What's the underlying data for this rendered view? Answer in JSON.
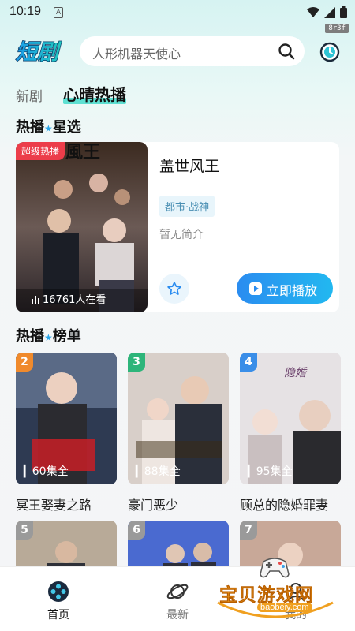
{
  "status": {
    "time": "10:19",
    "a_icon": "A",
    "badge": "8r3f"
  },
  "header": {
    "logo": "短剧",
    "search_placeholder": "人形机器天使心"
  },
  "tabs": [
    {
      "label": "新剧"
    },
    {
      "label": "心晴热播"
    }
  ],
  "sections": {
    "featured_title_a": "热播",
    "featured_title_b": "星选",
    "rank_title_a": "热播",
    "rank_title_b": "榜单"
  },
  "featured": {
    "tag": "超级热播",
    "views": "16761人在看",
    "title": "盖世风王",
    "genre": "都市·战神",
    "desc": "暂无简介",
    "play_label": "立即播放"
  },
  "ranking": [
    {
      "rank": "2",
      "title": "冥王娶妻之路",
      "eps": "60集全",
      "color": "#f08a2c"
    },
    {
      "rank": "3",
      "title": "豪门恶少",
      "eps": "88集全",
      "color": "#2db57a"
    },
    {
      "rank": "4",
      "title": "顾总的隐婚罪妻",
      "eps": "95集全",
      "color": "#3a8ee8"
    },
    {
      "rank": "5",
      "title": "",
      "eps": "",
      "color": "#9a9a9a"
    },
    {
      "rank": "6",
      "title": "",
      "eps": "",
      "color": "#9a9a9a"
    },
    {
      "rank": "7",
      "title": "",
      "eps": "",
      "color": "#9a9a9a"
    }
  ],
  "nav": [
    {
      "label": "首页"
    },
    {
      "label": "最新"
    },
    {
      "label": "我的"
    }
  ],
  "watermark": {
    "text": "宝贝游戏网",
    "url": "baobeiy.com"
  },
  "colors": {
    "accent": "#2a9df0",
    "tab_highlight": "#5ee0d2",
    "hot_tag": "#ec3d4a"
  }
}
